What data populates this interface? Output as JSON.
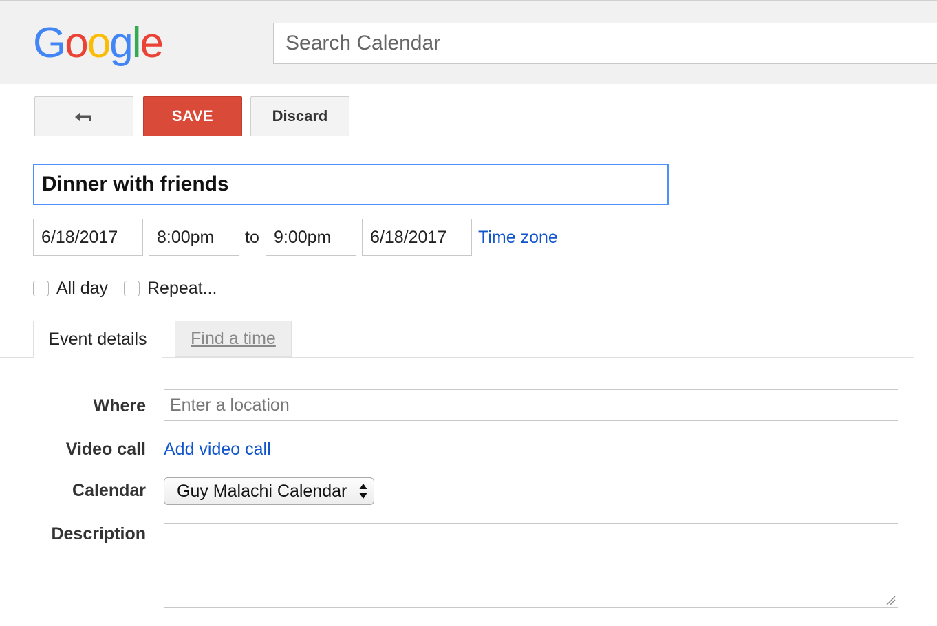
{
  "header": {
    "logo_letters": [
      {
        "ch": "G",
        "color": "#4285F4"
      },
      {
        "ch": "o",
        "color": "#EA4335"
      },
      {
        "ch": "o",
        "color": "#FBBC05"
      },
      {
        "ch": "g",
        "color": "#4285F4"
      },
      {
        "ch": "l",
        "color": "#34A853"
      },
      {
        "ch": "e",
        "color": "#EA4335"
      }
    ],
    "search_placeholder": "Search Calendar"
  },
  "toolbar": {
    "back_icon": "back-arrow-icon",
    "save_label": "SAVE",
    "discard_label": "Discard",
    "save_color": "#d94a38"
  },
  "event": {
    "title": "Dinner with friends",
    "start_date": "6/18/2017",
    "start_time": "8:00pm",
    "to_label": "to",
    "end_time": "9:00pm",
    "end_date": "6/18/2017",
    "timezone_link": "Time zone",
    "all_day_label": "All day",
    "repeat_label": "Repeat...",
    "all_day_checked": false,
    "repeat_checked": false
  },
  "tabs": {
    "event_details": "Event details",
    "find_a_time": "Find a time"
  },
  "details": {
    "where_label": "Where",
    "where_placeholder": "Enter a location",
    "video_label": "Video call",
    "video_link": "Add video call",
    "calendar_label": "Calendar",
    "calendar_value": "Guy Malachi Calendar",
    "description_label": "Description"
  },
  "colors": {
    "link": "#1155cc",
    "focus_border": "#4d90fe"
  }
}
